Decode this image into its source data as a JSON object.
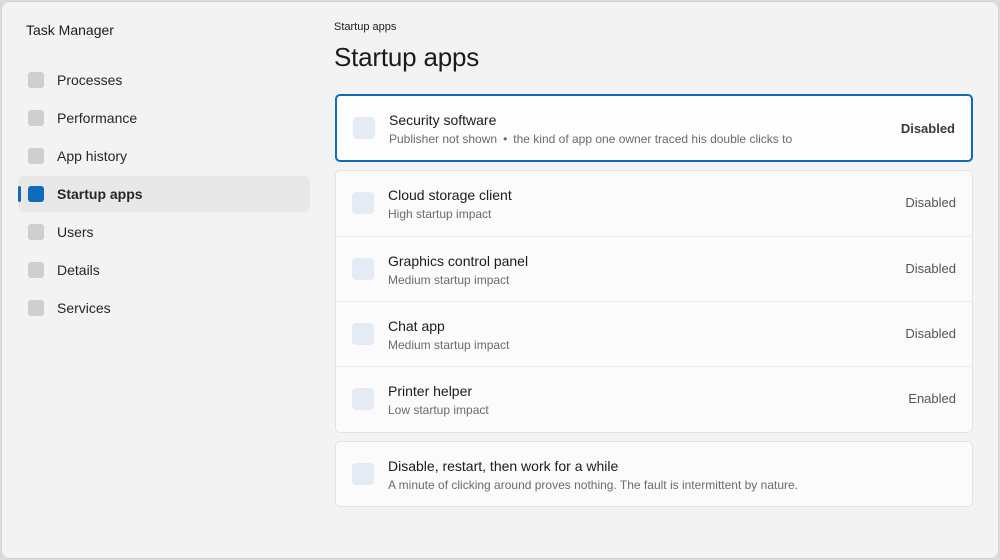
{
  "app": {
    "title": "Task Manager"
  },
  "sidebar": {
    "items": [
      {
        "label": "Processes",
        "icon": "processes-icon"
      },
      {
        "label": "Performance",
        "icon": "performance-icon"
      },
      {
        "label": "App history",
        "icon": "app-history-icon"
      },
      {
        "label": "Startup apps",
        "icon": "startup-apps-icon",
        "active": true
      },
      {
        "label": "Users",
        "icon": "users-icon"
      },
      {
        "label": "Details",
        "icon": "details-icon"
      },
      {
        "label": "Services",
        "icon": "services-icon"
      }
    ]
  },
  "main": {
    "breadcrumb": "Startup apps",
    "title": "Startup apps",
    "selected_app": {
      "name": "Security software",
      "publisher": "Publisher not shown",
      "separator": "•",
      "note": "the kind of app one owner traced his double clicks to",
      "status": "Disabled"
    },
    "apps": [
      {
        "name": "Cloud storage client",
        "impact": "High startup impact",
        "status": "Disabled"
      },
      {
        "name": "Graphics control panel",
        "impact": "Medium startup impact",
        "status": "Disabled"
      },
      {
        "name": "Chat app",
        "impact": "Medium startup impact",
        "status": "Disabled"
      },
      {
        "name": "Printer helper",
        "impact": "Low startup impact",
        "status": "Enabled"
      }
    ],
    "tip": {
      "title": "Disable, restart, then work for a while",
      "text": "A minute of clicking around proves nothing. The fault is intermittent by nature."
    }
  },
  "colors": {
    "accent": "#0f6cbd",
    "background": "#f3f3f3",
    "card": "#fbfbfb"
  }
}
